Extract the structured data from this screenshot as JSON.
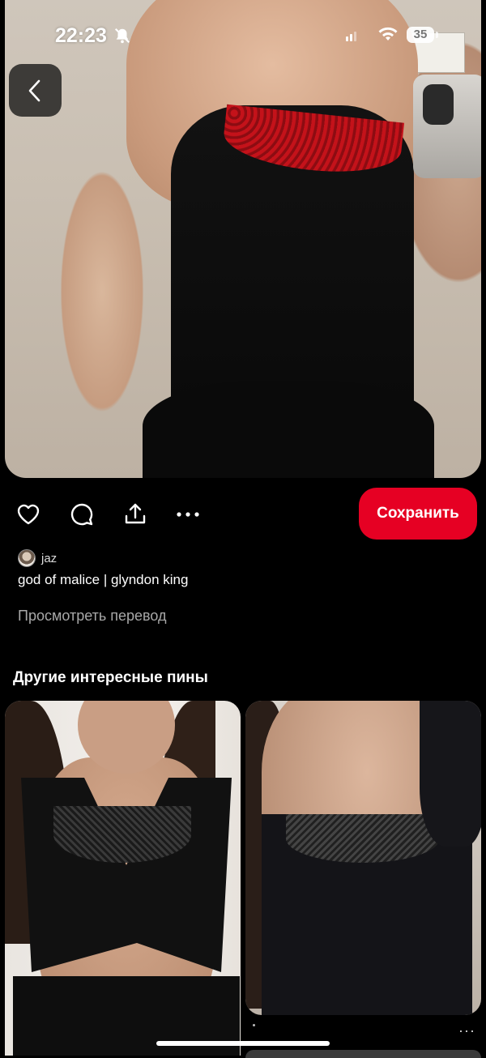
{
  "status_bar": {
    "time": "22:23",
    "battery": "35",
    "icons": [
      "bell-slash-icon",
      "cellular-signal-icon",
      "wifi-icon",
      "battery-icon"
    ]
  },
  "navigation": {
    "back_icon": "chevron-left-icon"
  },
  "actions": {
    "icons": [
      "heart-icon",
      "comment-icon",
      "share-icon",
      "more-icon"
    ],
    "save_label": "Сохранить",
    "save_color": "#e60023"
  },
  "pin": {
    "author": "jaz",
    "title": "god of malice | glyndon king",
    "translate_label": "Просмотреть перевод"
  },
  "related": {
    "heading": "Другие интересные пины",
    "more_label": "···"
  }
}
